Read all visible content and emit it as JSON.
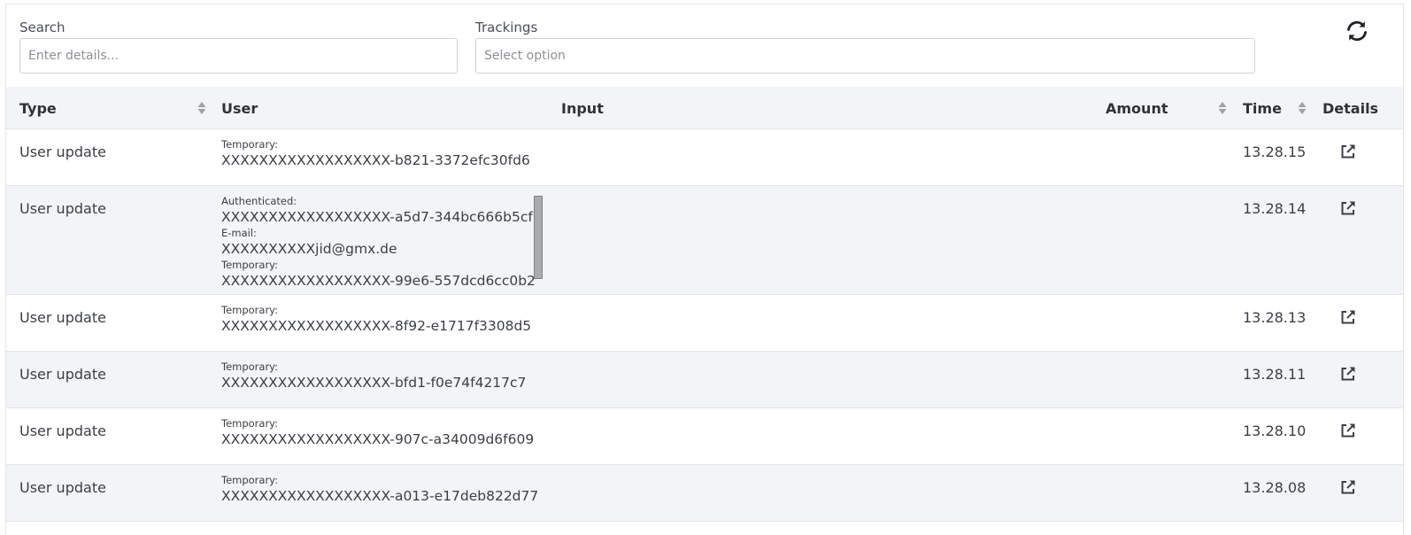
{
  "filters": {
    "search_label": "Search",
    "search_placeholder": "Enter details...",
    "trackings_label": "Trackings",
    "trackings_placeholder": "Select option",
    "refresh_icon": "refresh-icon"
  },
  "table": {
    "columns": {
      "type": "Type",
      "user": "User",
      "input": "Input",
      "amount": "Amount",
      "time": "Time",
      "details": "Details"
    },
    "rows": [
      {
        "type": "User update",
        "user": [
          {
            "label": "Temporary:",
            "value": "XXXXXXXXXXXXXXXXXX-b821-3372efc30fd6"
          }
        ],
        "time": "13.28.15"
      },
      {
        "type": "User update",
        "user": [
          {
            "label": "Authenticated:",
            "value": "XXXXXXXXXXXXXXXXXX-a5d7-344bc666b5cf"
          },
          {
            "label": "E-mail:",
            "value": "XXXXXXXXXXjid@gmx.de"
          },
          {
            "label": "Temporary:",
            "value": "XXXXXXXXXXXXXXXXXX-99e6-557dcd6cc0b2"
          }
        ],
        "time": "13.28.14"
      },
      {
        "type": "User update",
        "user": [
          {
            "label": "Temporary:",
            "value": "XXXXXXXXXXXXXXXXXX-8f92-e1717f3308d5"
          }
        ],
        "time": "13.28.13"
      },
      {
        "type": "User update",
        "user": [
          {
            "label": "Temporary:",
            "value": "XXXXXXXXXXXXXXXXXX-bfd1-f0e74f4217c7"
          }
        ],
        "time": "13.28.11"
      },
      {
        "type": "User update",
        "user": [
          {
            "label": "Temporary:",
            "value": "XXXXXXXXXXXXXXXXXX-907c-a34009d6f609"
          }
        ],
        "time": "13.28.10"
      },
      {
        "type": "User update",
        "user": [
          {
            "label": "Temporary:",
            "value": "XXXXXXXXXXXXXXXXXX-a013-e17deb822d77"
          }
        ],
        "time": "13.28.08"
      }
    ],
    "details_icon": "external-link-icon"
  }
}
